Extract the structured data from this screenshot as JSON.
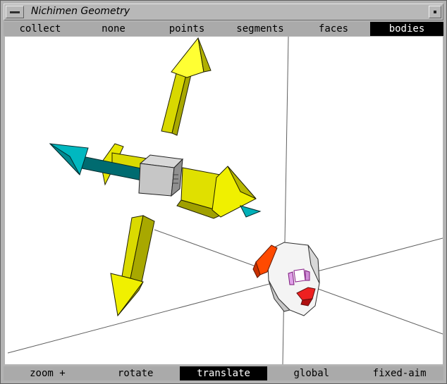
{
  "window": {
    "title": "Nichimen Geometry"
  },
  "selection_modes": [
    {
      "label": "collect",
      "active": false
    },
    {
      "label": "none",
      "active": false
    },
    {
      "label": "points",
      "active": false
    },
    {
      "label": "segments",
      "active": false
    },
    {
      "label": "faces",
      "active": false
    },
    {
      "label": "bodies",
      "active": true
    }
  ],
  "view_modes": [
    {
      "label": "zoom +",
      "active": false
    },
    {
      "label": "rotate",
      "active": false
    },
    {
      "label": "translate",
      "active": true
    },
    {
      "label": "global",
      "active": false
    },
    {
      "label": "fixed-aim",
      "active": false
    }
  ],
  "colors": {
    "manipulator_arrow": "#e6e600",
    "axis_handle": "#00a0a8",
    "head_accent": "#ff3300",
    "viewport_bg": "#ffffff"
  }
}
